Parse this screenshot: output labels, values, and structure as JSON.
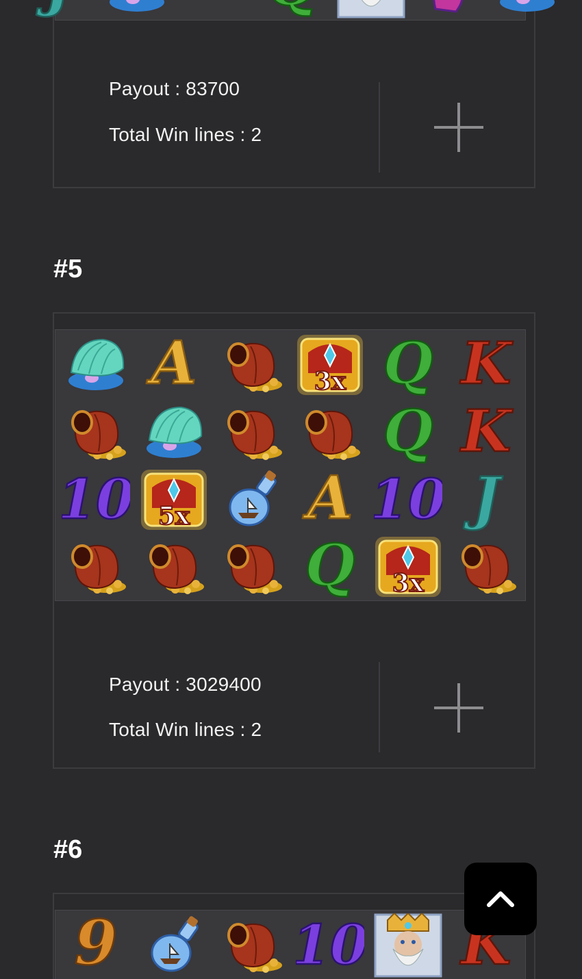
{
  "cards": [
    {
      "payout_text": "Payout : 83700",
      "winlines_text": "Total Win lines : 2",
      "expand_icon": "plus-icon",
      "visible_rows": [
        [
          "J",
          "shell",
          "",
          "Q",
          "poseidon",
          "seahorse",
          "shell"
        ]
      ]
    },
    {
      "heading": "#5",
      "payout_text": "Payout : 3029400",
      "winlines_text": "Total Win lines : 2",
      "expand_icon": "plus-icon",
      "rows": [
        [
          "shell",
          "A",
          "urn",
          "chest-3x",
          "Q",
          "K"
        ],
        [
          "urn",
          "shell",
          "urn",
          "urn",
          "Q",
          "K"
        ],
        [
          "10",
          "chest-5x",
          "bottle",
          "A",
          "10",
          "J"
        ],
        [
          "urn",
          "urn",
          "urn",
          "Q",
          "chest-3x",
          "urn"
        ]
      ],
      "multipliers": {
        "chest-3x": "3x",
        "chest-5x": "5x"
      }
    },
    {
      "heading": "#6",
      "visible_rows": [
        [
          "9",
          "bottle",
          "urn",
          "10",
          "poseidon",
          "K"
        ]
      ]
    }
  ],
  "scroll_top_icon": "chevron-up-icon",
  "colors": {
    "background": "#2a292b",
    "card_border": "#3c3b3e",
    "reel_bg": "#39383b",
    "gold": "#e8b23a",
    "green_q": "#3fae3a",
    "red_k": "#c8331f",
    "purple_10": "#7b3fe0",
    "teal_j": "#3aa8a0"
  }
}
